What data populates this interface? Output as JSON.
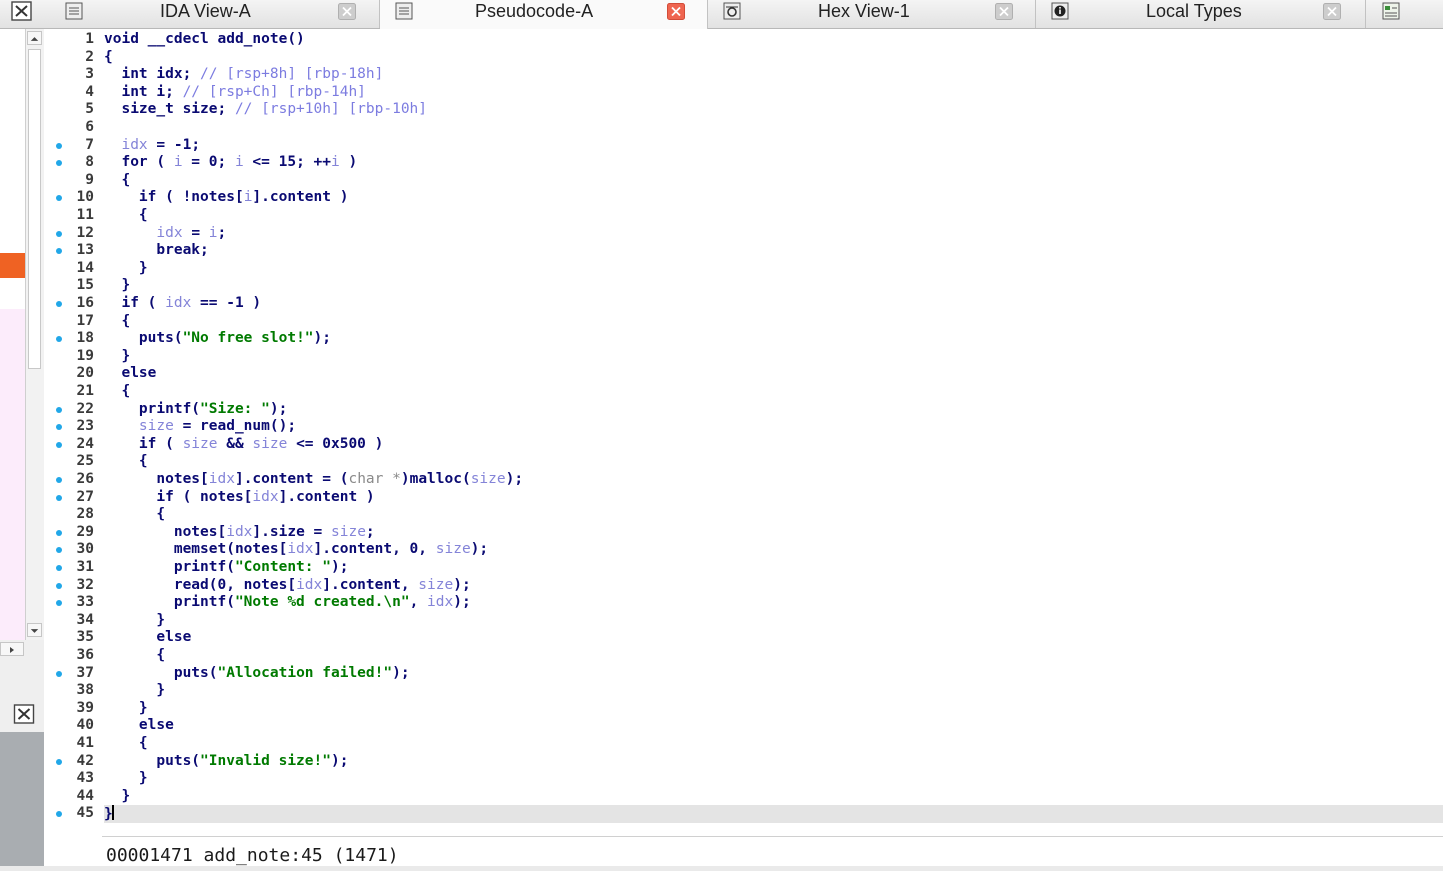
{
  "tabs": [
    {
      "label": "IDA View-A",
      "icon": "text-view-icon",
      "active": false
    },
    {
      "label": "Pseudocode-A",
      "icon": "text-view-icon",
      "active": true
    },
    {
      "label": "Hex View-1",
      "icon": "hex-view-icon",
      "active": false
    },
    {
      "label": "Local Types",
      "icon": "info-icon",
      "active": false
    }
  ],
  "colors": {
    "active_close": "#ef6550",
    "inactive_close": "#c9c9c9",
    "breakpoint_dot": "#21a7e8",
    "keyword": "#0a0a72",
    "variable": "#8484d8",
    "string": "#007a00",
    "comment": "#7c7ce0",
    "sidebar_marker": "#ef6223"
  },
  "code": [
    {
      "n": "1",
      "dot": false,
      "html": "void __cdecl add_note()"
    },
    {
      "n": "2",
      "dot": false,
      "html": "{"
    },
    {
      "n": "3",
      "dot": false,
      "html": "  int idx; <span class='t-cmt'>// [rsp+8h] [rbp-18h]</span>"
    },
    {
      "n": "4",
      "dot": false,
      "html": "  int i; <span class='t-cmt'>// [rsp+Ch] [rbp-14h]</span>"
    },
    {
      "n": "5",
      "dot": false,
      "html": "  size_t size; <span class='t-cmt'>// [rsp+10h] [rbp-10h]</span>"
    },
    {
      "n": "6",
      "dot": false,
      "html": ""
    },
    {
      "n": "7",
      "dot": true,
      "html": "  <span class='t-var'>idx</span> = -1;"
    },
    {
      "n": "8",
      "dot": true,
      "html": "  for ( <span class='t-var'>i</span> = 0; <span class='t-var'>i</span> &lt;= 15; ++<span class='t-var'>i</span> )"
    },
    {
      "n": "9",
      "dot": false,
      "html": "  {"
    },
    {
      "n": "10",
      "dot": true,
      "html": "    if ( !notes[<span class='t-var'>i</span>].content )"
    },
    {
      "n": "11",
      "dot": false,
      "html": "    {"
    },
    {
      "n": "12",
      "dot": true,
      "html": "      <span class='t-var'>idx</span> = <span class='t-var'>i</span>;"
    },
    {
      "n": "13",
      "dot": true,
      "html": "      break;"
    },
    {
      "n": "14",
      "dot": false,
      "html": "    }"
    },
    {
      "n": "15",
      "dot": false,
      "html": "  }"
    },
    {
      "n": "16",
      "dot": true,
      "html": "  if ( <span class='t-var'>idx</span> == -1 )"
    },
    {
      "n": "17",
      "dot": false,
      "html": "  {"
    },
    {
      "n": "18",
      "dot": true,
      "html": "    puts(<span class='t-str'>\"No free slot!\"</span>);"
    },
    {
      "n": "19",
      "dot": false,
      "html": "  }"
    },
    {
      "n": "20",
      "dot": false,
      "html": "  else"
    },
    {
      "n": "21",
      "dot": false,
      "html": "  {"
    },
    {
      "n": "22",
      "dot": true,
      "html": "    printf(<span class='t-str'>\"Size: \"</span>);"
    },
    {
      "n": "23",
      "dot": true,
      "html": "    <span class='t-var'>size</span> = read_num();"
    },
    {
      "n": "24",
      "dot": true,
      "html": "    if ( <span class='t-var'>size</span> &amp;&amp; <span class='t-var'>size</span> &lt;= 0x500 )"
    },
    {
      "n": "25",
      "dot": false,
      "html": "    {"
    },
    {
      "n": "26",
      "dot": true,
      "html": "      notes[<span class='t-var'>idx</span>].content = (<span class='t-typ'>char *</span>)malloc(<span class='t-var'>size</span>);"
    },
    {
      "n": "27",
      "dot": true,
      "html": "      if ( notes[<span class='t-var'>idx</span>].content )"
    },
    {
      "n": "28",
      "dot": false,
      "html": "      {"
    },
    {
      "n": "29",
      "dot": true,
      "html": "        notes[<span class='t-var'>idx</span>].size = <span class='t-var'>size</span>;"
    },
    {
      "n": "30",
      "dot": true,
      "html": "        memset(notes[<span class='t-var'>idx</span>].content, 0, <span class='t-var'>size</span>);"
    },
    {
      "n": "31",
      "dot": true,
      "html": "        printf(<span class='t-str'>\"Content: \"</span>);"
    },
    {
      "n": "32",
      "dot": true,
      "html": "        read(0, notes[<span class='t-var'>idx</span>].content, <span class='t-var'>size</span>);"
    },
    {
      "n": "33",
      "dot": true,
      "html": "        printf(<span class='t-str'>\"Note %d created.\\n\"</span>, <span class='t-var'>idx</span>);"
    },
    {
      "n": "34",
      "dot": false,
      "html": "      }"
    },
    {
      "n": "35",
      "dot": false,
      "html": "      else"
    },
    {
      "n": "36",
      "dot": false,
      "html": "      {"
    },
    {
      "n": "37",
      "dot": true,
      "html": "        puts(<span class='t-str'>\"Allocation failed!\"</span>);"
    },
    {
      "n": "38",
      "dot": false,
      "html": "      }"
    },
    {
      "n": "39",
      "dot": false,
      "html": "    }"
    },
    {
      "n": "40",
      "dot": false,
      "html": "    else"
    },
    {
      "n": "41",
      "dot": false,
      "html": "    {"
    },
    {
      "n": "42",
      "dot": true,
      "html": "      puts(<span class='t-str'>\"Invalid size!\"</span>);"
    },
    {
      "n": "43",
      "dot": false,
      "html": "    }"
    },
    {
      "n": "44",
      "dot": false,
      "html": "  }"
    },
    {
      "n": "45",
      "dot": true,
      "html": "}",
      "current": true
    }
  ],
  "status": {
    "text": "00001471 add_note:45 (1471)"
  }
}
